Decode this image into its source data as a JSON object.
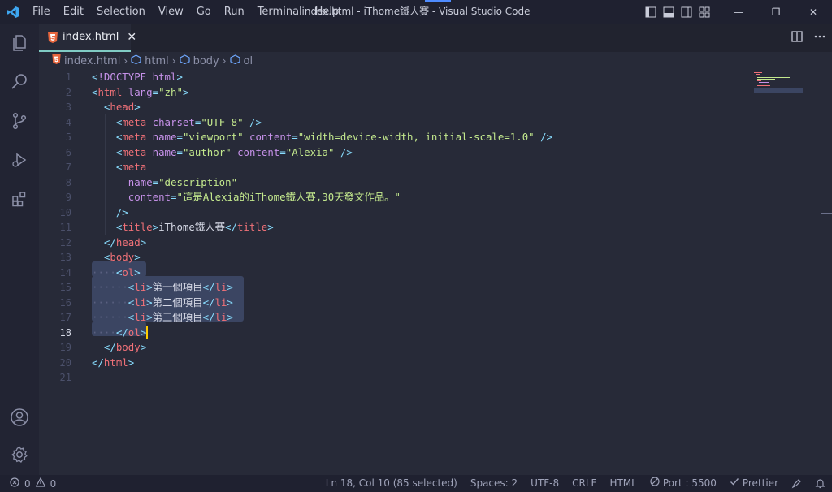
{
  "window": {
    "title": "index.html - iThome鐵人賽 - Visual Studio Code",
    "menu": [
      "File",
      "Edit",
      "Selection",
      "View",
      "Go",
      "Run",
      "Terminal",
      "Help"
    ],
    "controls": {
      "minimize": "—",
      "restore": "❐",
      "close": "✕"
    }
  },
  "activity_bar": {
    "items": [
      "files-icon",
      "search-icon",
      "source-control-icon",
      "run-debug-icon",
      "extensions-icon"
    ],
    "bottom": [
      "account-icon",
      "settings-gear-icon"
    ]
  },
  "tab": {
    "label": "index.html",
    "close": "✕",
    "active": true
  },
  "breadcrumb": [
    "index.html",
    "html",
    "body",
    "ol"
  ],
  "editor": {
    "active_line": 18,
    "lines": [
      "<!DOCTYPE html>",
      "<html lang=\"zh\">",
      "  <head>",
      "    <meta charset=\"UTF-8\" />",
      "    <meta name=\"viewport\" content=\"width=device-width, initial-scale=1.0\" />",
      "    <meta name=\"author\" content=\"Alexia\" />",
      "    <meta",
      "      name=\"description\"",
      "      content=\"這是Alexia的iThome鐵人賽,30天發文作品。\"",
      "    />",
      "    <title>iThome鐵人賽</title>",
      "  </head>",
      "  <body>",
      "    <ol>",
      "      <li>第一個項目</li>",
      "      <li>第二個項目</li>",
      "      <li>第三個項目</li>",
      "    </ol>",
      "  </body>",
      "</html>",
      ""
    ]
  },
  "status_bar": {
    "errors": "0",
    "warnings": "0",
    "position": "Ln 18, Col 10 (85 selected)",
    "spaces": "Spaces: 2",
    "encoding": "UTF-8",
    "eol": "CRLF",
    "language": "HTML",
    "port": "Port : 5500",
    "prettier": "Prettier"
  },
  "colors": {
    "background": "#272a38",
    "selection": "#3b4562",
    "tag": "#f07178",
    "attribute": "#c792ea",
    "string": "#c3e88d",
    "punctuation": "#89ddff",
    "cursor": "#ffcc00",
    "tab_indicator": "#80cbc4"
  }
}
